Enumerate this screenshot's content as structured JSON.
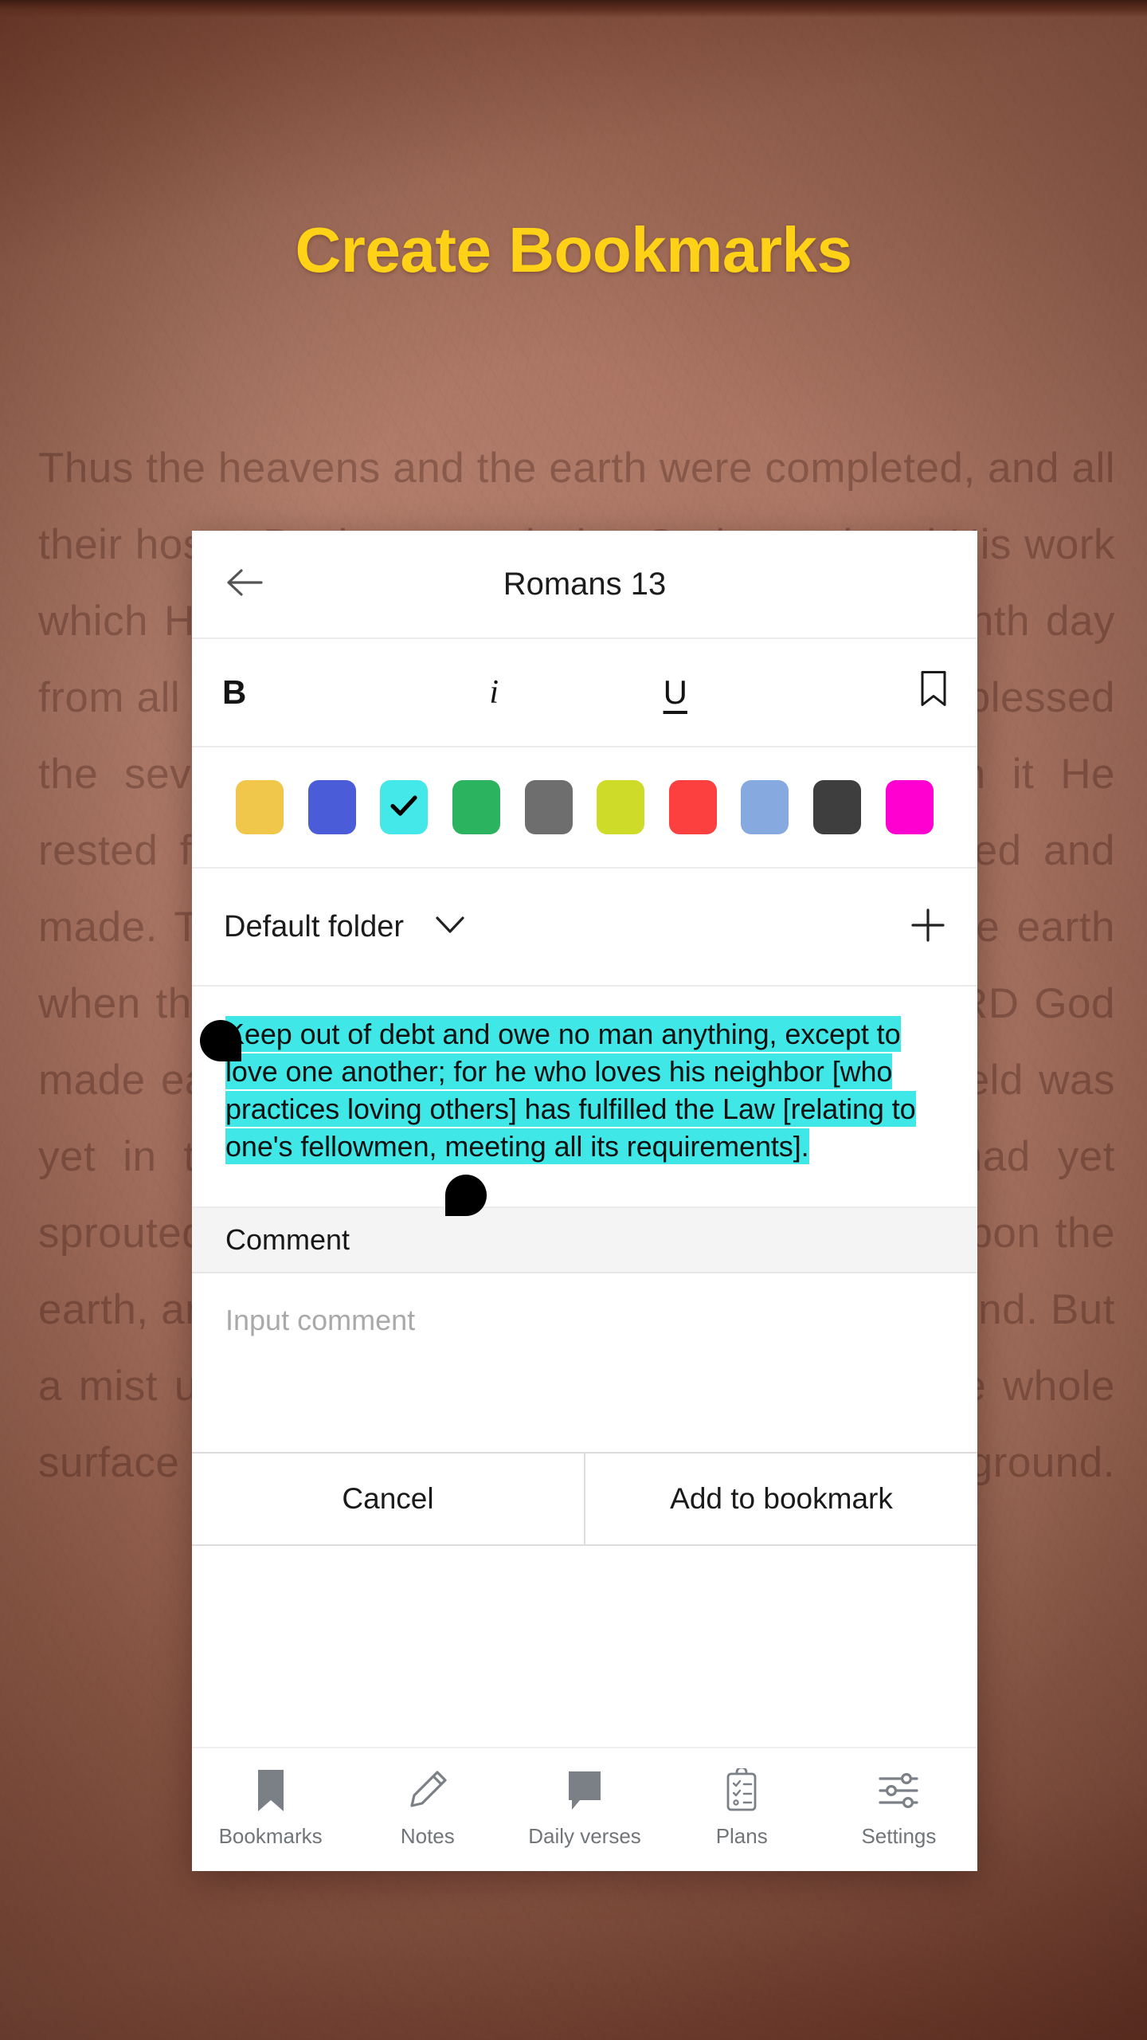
{
  "headline": "Create Bookmarks",
  "background": {
    "verse_text": "Thus the heavens and the earth were completed, and all their hosts. By the seventh day God completed His work which He had done, and He rested on the seventh day from all His work which He had done. Then God blessed the seventh day and sanctified it, because in it He rested from all His work which God had created and made. This is the history of the heavens and the earth when they were created, in the day that the LORD God made earth and heaven. Now no shrub of the field was yet in the earth, and no plant of the field had yet sprouted, for the LORD God had not sent rain upon the earth, and there was no man to cultivate the ground. But a mist used to rise from the earth and water the whole surface of the ground.",
    "wall_color": "#9d6753"
  },
  "app": {
    "title_bar": {
      "back_icon": "arrow-left-icon",
      "title": "Romans 13"
    },
    "format_bar": {
      "bold_label": "B",
      "italic_label": "i",
      "underline_label": "U",
      "bookmark_icon": "bookmark-outline-icon"
    },
    "palette": {
      "selected_index": 2,
      "check_icon": "check-icon",
      "swatches": [
        {
          "name": "yellow",
          "color": "#F0C74B"
        },
        {
          "name": "indigo",
          "color": "#4A5CD8"
        },
        {
          "name": "cyan",
          "color": "#45E8E8"
        },
        {
          "name": "green",
          "color": "#2BB35F"
        },
        {
          "name": "gray",
          "color": "#6E6E6E"
        },
        {
          "name": "lime",
          "color": "#CEDC29"
        },
        {
          "name": "red",
          "color": "#FC4040"
        },
        {
          "name": "light-blue",
          "color": "#86A9E0"
        },
        {
          "name": "dark-gray",
          "color": "#3E3E3E"
        },
        {
          "name": "magenta",
          "color": "#FF00D0"
        }
      ]
    },
    "folder_row": {
      "folder_name": "Default folder",
      "caret_icon": "chevron-down-icon",
      "add_icon": "plus-icon"
    },
    "verse": {
      "highlighted_text": "Keep out of debt and owe no man anything, except to love one another; for he who loves his neighbor [who practices loving others] has fulfilled the Law [relating to one's fellowmen, meeting all its requirements].",
      "highlight_color": "#3FE7E7",
      "selection_handle_icon": "text-selection-handle-icon"
    },
    "comment": {
      "section_label": "Comment",
      "placeholder": "Input comment",
      "value": ""
    },
    "actions": {
      "cancel_label": "Cancel",
      "confirm_label": "Add to bookmark"
    },
    "bottom_nav": {
      "items": [
        {
          "label": "Bookmarks",
          "icon": "bookmark-filled-icon"
        },
        {
          "label": "Notes",
          "icon": "pencil-icon"
        },
        {
          "label": "Daily verses",
          "icon": "speech-bubble-icon"
        },
        {
          "label": "Plans",
          "icon": "clipboard-checklist-icon"
        },
        {
          "label": "Settings",
          "icon": "sliders-icon"
        }
      ],
      "icon_color": "#7A8086"
    }
  }
}
